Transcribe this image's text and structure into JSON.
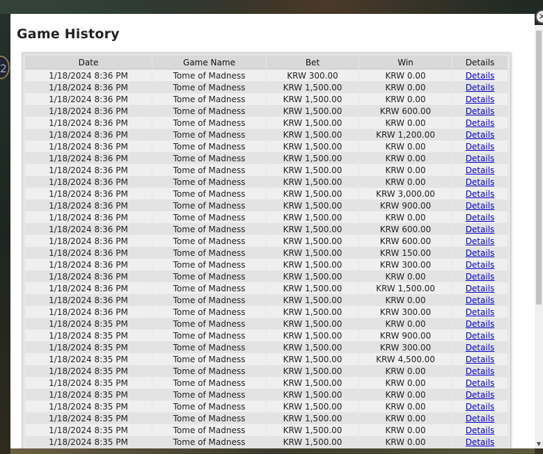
{
  "modal": {
    "title": "Game History",
    "close_glyph": "✕"
  },
  "table": {
    "headers": [
      "Date",
      "Game Name",
      "Bet",
      "Win",
      "Details"
    ],
    "rows": [
      [
        "1/18/2024 8:36 PM",
        "Tome of Madness",
        "KRW 300.00",
        "KRW 0.00",
        "Details"
      ],
      [
        "1/18/2024 8:36 PM",
        "Tome of Madness",
        "KRW 1,500.00",
        "KRW 0.00",
        "Details"
      ],
      [
        "1/18/2024 8:36 PM",
        "Tome of Madness",
        "KRW 1,500.00",
        "KRW 0.00",
        "Details"
      ],
      [
        "1/18/2024 8:36 PM",
        "Tome of Madness",
        "KRW 1,500.00",
        "KRW 600.00",
        "Details"
      ],
      [
        "1/18/2024 8:36 PM",
        "Tome of Madness",
        "KRW 1,500.00",
        "KRW 0.00",
        "Details"
      ],
      [
        "1/18/2024 8:36 PM",
        "Tome of Madness",
        "KRW 1,500.00",
        "KRW 1,200.00",
        "Details"
      ],
      [
        "1/18/2024 8:36 PM",
        "Tome of Madness",
        "KRW 1,500.00",
        "KRW 0.00",
        "Details"
      ],
      [
        "1/18/2024 8:36 PM",
        "Tome of Madness",
        "KRW 1,500.00",
        "KRW 0.00",
        "Details"
      ],
      [
        "1/18/2024 8:36 PM",
        "Tome of Madness",
        "KRW 1,500.00",
        "KRW 0.00",
        "Details"
      ],
      [
        "1/18/2024 8:36 PM",
        "Tome of Madness",
        "KRW 1,500.00",
        "KRW 0.00",
        "Details"
      ],
      [
        "1/18/2024 8:36 PM",
        "Tome of Madness",
        "KRW 1,500.00",
        "KRW 3,000.00",
        "Details"
      ],
      [
        "1/18/2024 8:36 PM",
        "Tome of Madness",
        "KRW 1,500.00",
        "KRW 900.00",
        "Details"
      ],
      [
        "1/18/2024 8:36 PM",
        "Tome of Madness",
        "KRW 1,500.00",
        "KRW 0.00",
        "Details"
      ],
      [
        "1/18/2024 8:36 PM",
        "Tome of Madness",
        "KRW 1,500.00",
        "KRW 600.00",
        "Details"
      ],
      [
        "1/18/2024 8:36 PM",
        "Tome of Madness",
        "KRW 1,500.00",
        "KRW 600.00",
        "Details"
      ],
      [
        "1/18/2024 8:36 PM",
        "Tome of Madness",
        "KRW 1,500.00",
        "KRW 150.00",
        "Details"
      ],
      [
        "1/18/2024 8:36 PM",
        "Tome of Madness",
        "KRW 1,500.00",
        "KRW 300.00",
        "Details"
      ],
      [
        "1/18/2024 8:36 PM",
        "Tome of Madness",
        "KRW 1,500.00",
        "KRW 0.00",
        "Details"
      ],
      [
        "1/18/2024 8:36 PM",
        "Tome of Madness",
        "KRW 1,500.00",
        "KRW 1,500.00",
        "Details"
      ],
      [
        "1/18/2024 8:36 PM",
        "Tome of Madness",
        "KRW 1,500.00",
        "KRW 0.00",
        "Details"
      ],
      [
        "1/18/2024 8:36 PM",
        "Tome of Madness",
        "KRW 1,500.00",
        "KRW 300.00",
        "Details"
      ],
      [
        "1/18/2024 8:35 PM",
        "Tome of Madness",
        "KRW 1,500.00",
        "KRW 0.00",
        "Details"
      ],
      [
        "1/18/2024 8:35 PM",
        "Tome of Madness",
        "KRW 1,500.00",
        "KRW 900.00",
        "Details"
      ],
      [
        "1/18/2024 8:35 PM",
        "Tome of Madness",
        "KRW 1,500.00",
        "KRW 300.00",
        "Details"
      ],
      [
        "1/18/2024 8:35 PM",
        "Tome of Madness",
        "KRW 1,500.00",
        "KRW 4,500.00",
        "Details"
      ],
      [
        "1/18/2024 8:35 PM",
        "Tome of Madness",
        "KRW 1,500.00",
        "KRW 0.00",
        "Details"
      ],
      [
        "1/18/2024 8:35 PM",
        "Tome of Madness",
        "KRW 1,500.00",
        "KRW 0.00",
        "Details"
      ],
      [
        "1/18/2024 8:35 PM",
        "Tome of Madness",
        "KRW 1,500.00",
        "KRW 0.00",
        "Details"
      ],
      [
        "1/18/2024 8:35 PM",
        "Tome of Madness",
        "KRW 1,500.00",
        "KRW 0.00",
        "Details"
      ],
      [
        "1/18/2024 8:35 PM",
        "Tome of Madness",
        "KRW 1,500.00",
        "KRW 0.00",
        "Details"
      ],
      [
        "1/18/2024 8:35 PM",
        "Tome of Madness",
        "KRW 1,500.00",
        "KRW 0.00",
        "Details"
      ],
      [
        "1/18/2024 8:35 PM",
        "Tome of Madness",
        "KRW 1,500.00",
        "KRW 0.00",
        "Details"
      ]
    ]
  },
  "background": {
    "badge_text": "2"
  },
  "scrollbar": {
    "down_arrow": "▼"
  },
  "colors": {
    "link": "#0000cc",
    "row_odd": "#efefef",
    "row_even": "#e3e3e3",
    "header_bg": "#d9d9d9"
  }
}
